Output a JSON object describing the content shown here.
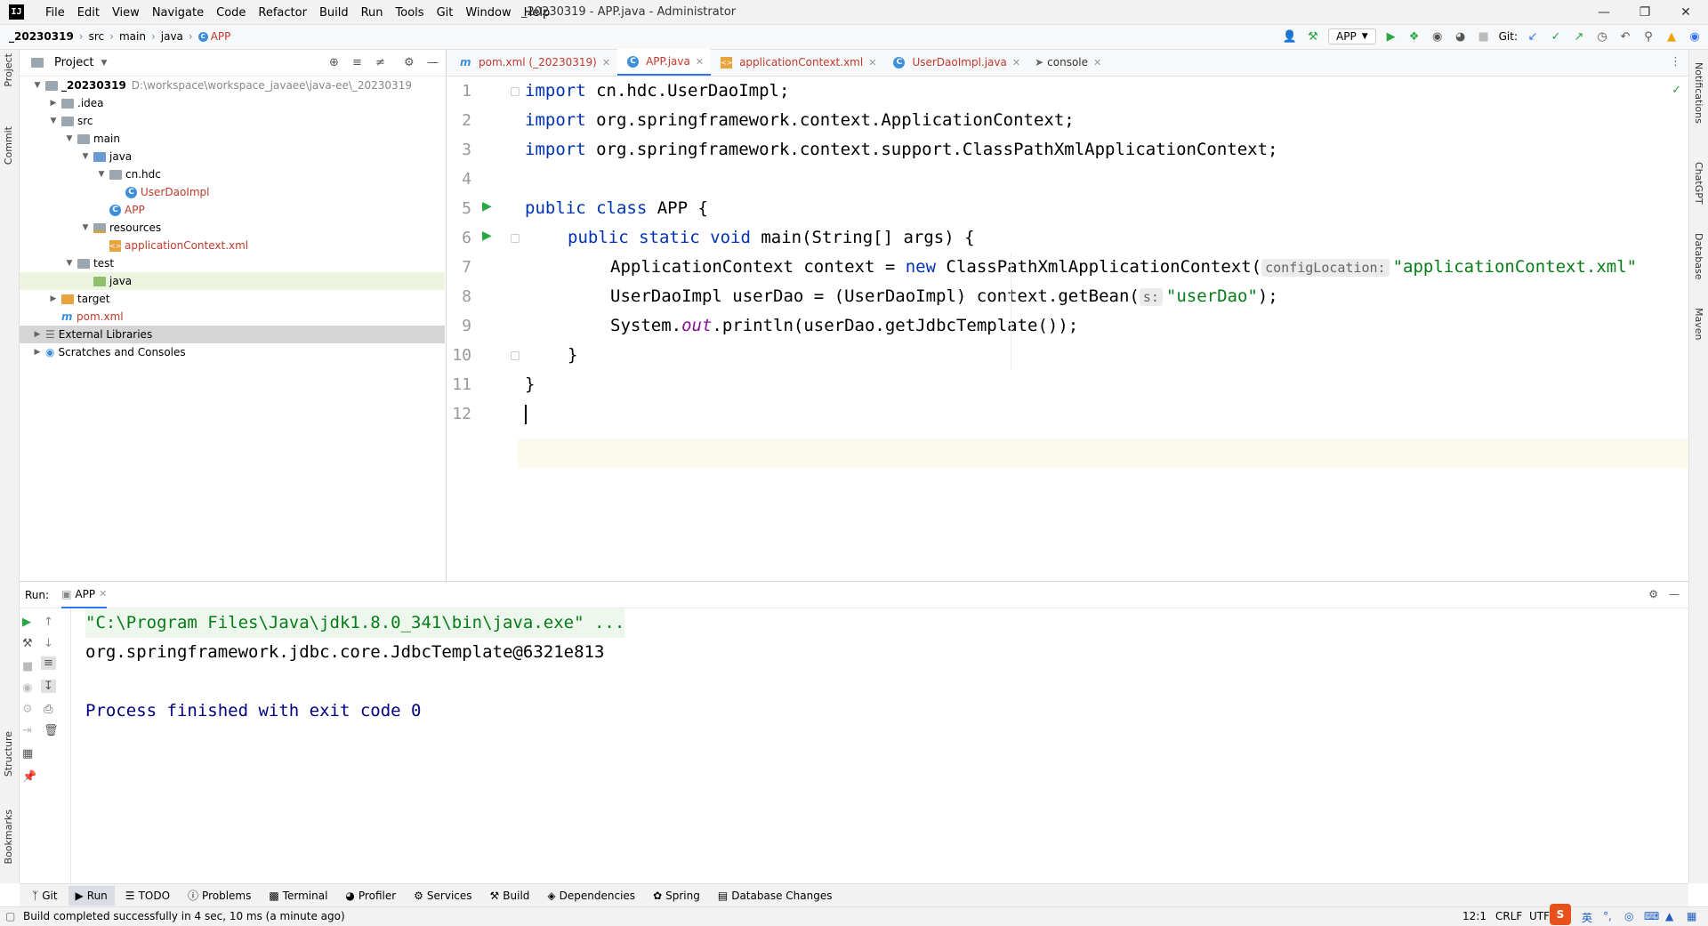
{
  "titlebar": {
    "menu": [
      "File",
      "Edit",
      "View",
      "Navigate",
      "Code",
      "Refactor",
      "Build",
      "Run",
      "Tools",
      "Git",
      "Window",
      "Help"
    ],
    "title": "_20230319 - APP.java - Administrator"
  },
  "navbar": {
    "crumbs": [
      "_20230319",
      "src",
      "main",
      "java",
      "APP"
    ],
    "run_config": "APP",
    "git_label": "Git:"
  },
  "left_strip": [
    "Project",
    "Commit",
    "Structure",
    "Bookmarks"
  ],
  "right_strip": [
    "Notifications",
    "ChatGPT",
    "Database",
    "Maven"
  ],
  "project": {
    "header": "Project",
    "tree": [
      {
        "label": "_20230319",
        "path": "D:\\workspace\\workspace_javaee\\java-ee\\_20230319"
      },
      {
        "label": ".idea"
      },
      {
        "label": "src"
      },
      {
        "label": "main"
      },
      {
        "label": "java"
      },
      {
        "label": "cn.hdc"
      },
      {
        "label": "UserDaoImpl"
      },
      {
        "label": "APP"
      },
      {
        "label": "resources"
      },
      {
        "label": "applicationContext.xml"
      },
      {
        "label": "test"
      },
      {
        "label": "java"
      },
      {
        "label": "target"
      },
      {
        "label": "pom.xml"
      },
      {
        "label": "External Libraries"
      },
      {
        "label": "Scratches and Consoles"
      }
    ]
  },
  "editor": {
    "tabs": [
      "pom.xml (_20230319)",
      "APP.java",
      "applicationContext.xml",
      "UserDaoImpl.java",
      "console"
    ],
    "line_numbers": [
      "1",
      "2",
      "3",
      "4",
      "5",
      "6",
      "7",
      "8",
      "9",
      "10",
      "11",
      "12"
    ],
    "code": {
      "l1_kw": "import",
      "l1_rest": " cn.hdc.UserDaoImpl;",
      "l2_kw": "import",
      "l2_rest": " org.springframework.context.ApplicationContext;",
      "l3_kw": "import",
      "l3_rest": " org.springframework.context.support.ClassPathXmlApplicationContext;",
      "l5_kw": "public class",
      "l5_rest": " APP {",
      "l6_kw": "public static void",
      "l6_rest": " main(String[] args) {",
      "l7_a": "ApplicationContext context = ",
      "l7_kw": "new",
      "l7_b": " ClassPathXmlApplicationContext(",
      "l7_hint": "configLocation:",
      "l7_str": "\"applicationContext.xml\"",
      "l8_a": "UserDaoImpl userDao = (UserDaoImpl) context.getBean(",
      "l8_hint": "s:",
      "l8_str": "\"userDao\"",
      "l8_b": ");",
      "l9_a": "System.",
      "l9_fld": "out",
      "l9_b": ".println(userDao.getJdbcTemplate());",
      "l10": "}",
      "l11": "}"
    }
  },
  "run": {
    "label": "Run:",
    "tab": "APP",
    "console": [
      "\"C:\\Program Files\\Java\\jdk1.8.0_341\\bin\\java.exe\" ...",
      "org.springframework.jdbc.core.JdbcTemplate@6321e813",
      "Process finished with exit code 0"
    ]
  },
  "bottom_tabs": [
    "Git",
    "Run",
    "TODO",
    "Problems",
    "Terminal",
    "Profiler",
    "Services",
    "Build",
    "Dependencies",
    "Spring",
    "Database Changes"
  ],
  "status": {
    "message": "Build completed successfully in 4 sec, 10 ms (a minute ago)",
    "position": "12:1",
    "line_sep": "CRLF",
    "encoding": "UTF-",
    "ime": "英"
  },
  "colors": {
    "keyword": "#0033b3",
    "string": "#067d17",
    "field": "#871094",
    "run_green": "#27a844",
    "accent": "#3574f0"
  }
}
